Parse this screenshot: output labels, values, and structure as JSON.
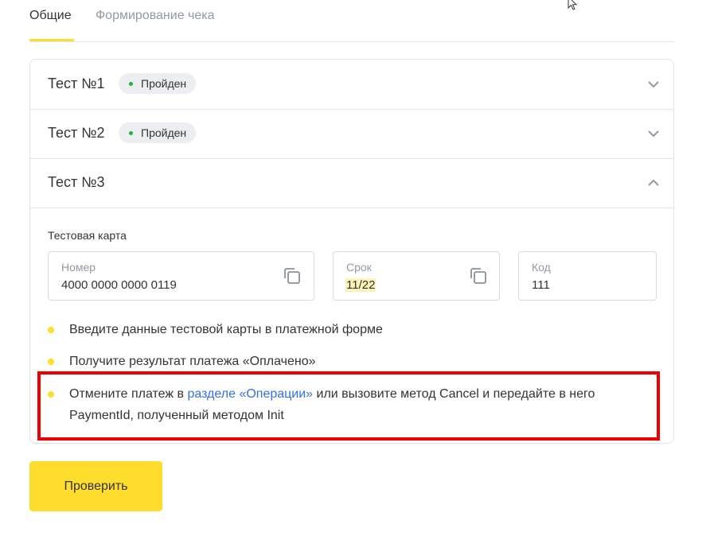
{
  "tabs": [
    {
      "label": "Общие",
      "active": true
    },
    {
      "label": "Формирование чека",
      "active": false
    }
  ],
  "accordion": {
    "items": [
      {
        "title": "Тест №1",
        "badge": "Пройден",
        "expanded": false
      },
      {
        "title": "Тест №2",
        "badge": "Пройден",
        "expanded": false
      },
      {
        "title": "Тест №3",
        "expanded": true
      }
    ],
    "card_label": "Тестовая карта",
    "fields": [
      {
        "label": "Номер",
        "value": "4000 0000 0000 0119"
      },
      {
        "label": "Срок",
        "value": "11/22"
      },
      {
        "label": "Код",
        "value": "111"
      }
    ],
    "steps": [
      {
        "text": "Введите данные тестовой карты в платежной форме"
      },
      {
        "text": "Получите результат платежа «Оплачено»"
      },
      {
        "before": "Отмените платеж в ",
        "link": "разделе «Операции»",
        "after": " или вызовите метод Cancel и передайте в него PaymentId, полученный методом Init"
      }
    ]
  },
  "check_button": "Проверить",
  "colors": {
    "accent": "#ffdd2d",
    "success": "#1fb43b",
    "link": "#336fee",
    "highlight_frame": "#ee0000"
  }
}
